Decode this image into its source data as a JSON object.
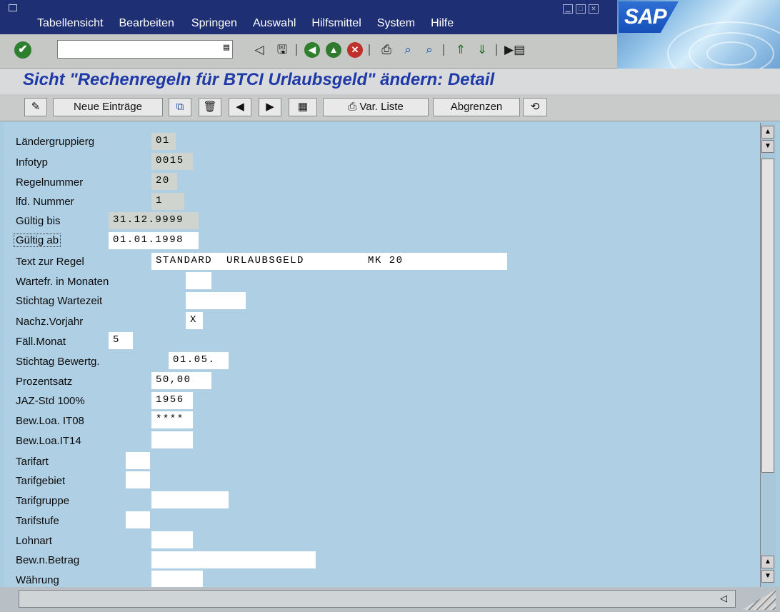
{
  "menu": {
    "items": [
      "Tabellensicht",
      "Bearbeiten",
      "Springen",
      "Auswahl",
      "Hilfsmittel",
      "System",
      "Hilfe"
    ]
  },
  "brand": {
    "logo_text": "SAP"
  },
  "std_toolbar": {
    "command_value": "",
    "icons": [
      "enter-icon",
      "save-icon",
      "back-icon",
      "exit-icon",
      "cancel-icon",
      "print-icon",
      "find-icon",
      "find-next-icon",
      "first-page-icon",
      "last-page-icon",
      "layout-icon"
    ]
  },
  "title": "Sicht \"Rechenregeln für BTCI Urlaubsgeld\" ändern: Detail",
  "app_toolbar": {
    "new_entries": "Neue Einträge",
    "var_list": "Var. Liste",
    "delimit": "Abgrenzen"
  },
  "form": {
    "fields": [
      {
        "label": "Ländergruppierg",
        "value": "01"
      },
      {
        "label": "Infotyp",
        "value": "0015"
      },
      {
        "label": "Regelnummer",
        "value": "20"
      },
      {
        "label": "lfd. Nummer",
        "value": "1"
      },
      {
        "label": "Gültig bis",
        "value": "31.12.9999"
      },
      {
        "label": "Gültig ab",
        "value": "01.01.1998"
      },
      {
        "label": "Text zur Regel",
        "value": "STANDARD  URLAUBSGELD         MK 20"
      },
      {
        "label": "Wartefr. in Monaten",
        "value": ""
      },
      {
        "label": "Stichtag Wartezeit",
        "value": ""
      },
      {
        "label": "Nachz.Vorjahr",
        "value": "X"
      },
      {
        "label": "Fäll.Monat",
        "value": "5"
      },
      {
        "label": "Stichtag Bewertg.",
        "value": "01.05."
      },
      {
        "label": "Prozentsatz",
        "value": "50,00"
      },
      {
        "label": "JAZ-Std 100%",
        "value": "1956"
      },
      {
        "label": "Bew.Loa. IT08",
        "value": "****"
      },
      {
        "label": "Bew.Loa.IT14",
        "value": ""
      },
      {
        "label": "Tarifart",
        "value": ""
      },
      {
        "label": "Tarifgebiet",
        "value": ""
      },
      {
        "label": "Tarifgruppe",
        "value": ""
      },
      {
        "label": "Tarifstufe",
        "value": ""
      },
      {
        "label": "Lohnart",
        "value": ""
      },
      {
        "label": "Bew.n.Betrag",
        "value": ""
      },
      {
        "label": "Währung",
        "value": ""
      }
    ]
  },
  "status": {
    "message": ""
  },
  "colors": {
    "menubar": "#1f2f73",
    "title": "#1f3aa7",
    "content": "#aecfe4"
  }
}
